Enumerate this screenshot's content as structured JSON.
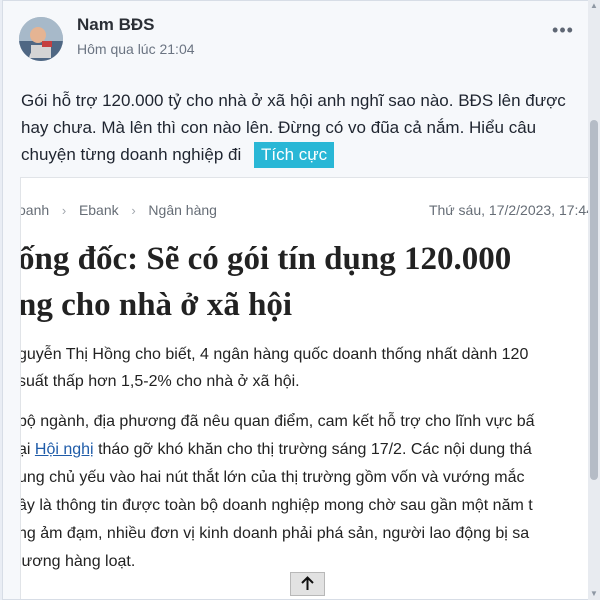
{
  "post": {
    "author": "Nam BĐS",
    "time": "Hôm qua lúc 21:04",
    "more_icon": "more-horizontal-icon",
    "text": "Gói hỗ trợ 120.000 tỷ cho nhà ở xã hội anh nghĩ sao nào. BĐS lên được hay chưa. Mà lên thì con nào lên. Đừng có vo đũa cả nắm. Hiểu câu chuyện từng doanh nghiệp đi",
    "tag": "Tích cực"
  },
  "article": {
    "breadcrumb": {
      "items": [
        "oanh",
        "Ebank",
        "Ngân hàng"
      ],
      "separator_icon": "chevron-right-icon"
    },
    "date": "Thứ sáu, 17/2/2023, 17:44",
    "headline_line1": "ống đốc: Sẽ có gói tín dụng 120.000",
    "headline_line2": "ng cho nhà ở xã hội",
    "lead_line1": "guyễn Thị Hồng cho biết, 4 ngân hàng quốc doanh thống nhất dành 120",
    "lead_line2": "suất thấp hơn 1,5-2% cho nhà ở xã hội.",
    "body": {
      "line1": "bộ ngành, địa phương đã nêu quan điểm, cam kết hỗ trợ cho lĩnh vực bấ",
      "line2_pre": "ại",
      "line2_link": "Hội nghị",
      "line2_post": "tháo gỡ khó khăn cho thị trường sáng 17/2. Các nội dung thá",
      "line3": "ung chủ yếu vào hai nút thắt lớn của thị trường gồm vốn và vướng mắc",
      "line4": "ây là thông tin được toàn bộ doanh nghiệp mong chờ sau gần một năm t",
      "line5": "ng ảm đạm, nhiều đơn vị kinh doanh phải phá sản, người lao động bị sa",
      "line6": "lương hàng loạt."
    }
  },
  "ui": {
    "back_to_top_icon": "arrow-up-icon",
    "scroll_up_icon": "scroll-up-arrow-icon",
    "scroll_down_icon": "scroll-down-arrow-icon"
  },
  "colors": {
    "tag_background": "#29b7d6",
    "link": "#1f5ca9"
  }
}
